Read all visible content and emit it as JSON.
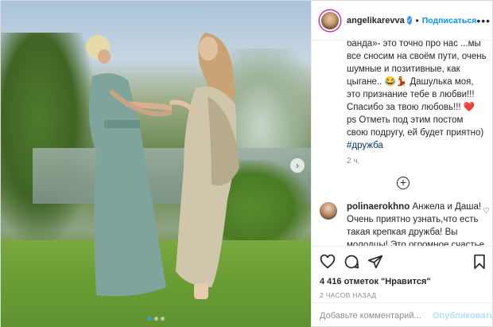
{
  "header": {
    "username": "angelikarevva",
    "follow_label": "Подписаться",
    "separator": "•",
    "more": "•••"
  },
  "caption": {
    "line1": "банда»- это точно про нас ...мы все сносим на своём пути, очень шумные и позитивные, как цыгане..",
    "emoji1": "😂💃",
    "line2": "Дашулька моя, это признание тебе в любви!!! Спасибо за твою любовь!!!",
    "heart": "❤️",
    "line3": "ps Отметь под этим постом свою подругу, ей будет приятно)",
    "hashtag": "#дружба",
    "time": "2 ч."
  },
  "load_more": "+",
  "comment": {
    "username": "polinaerokhno",
    "text": "Анжела и Даша! Очень приятно узнать,что есть такая крепкая дружба! Вы молодцы! Это огромное счастье найти друг друга,наверно это так же важно,как выйти замуж за достойного мужчину. Долгих"
  },
  "actions": {
    "likes_count": "4 416",
    "likes_text": "отметок \"Нравится\"",
    "posted_ago": "2 ЧАСОВ НАЗАД"
  },
  "add_comment": {
    "placeholder": "Добавьте комментарий...",
    "publish_label": "Опубликовать"
  },
  "photo": {
    "next_arrow": "›",
    "slides_total": 3,
    "active_slide": 1
  },
  "colors": {
    "accent": "#0095f6",
    "border": "#dbdbdb",
    "muted": "#8e8e8e",
    "publish_disabled": "#b2dffc"
  },
  "icons": [
    "heart-icon",
    "comment-icon",
    "share-icon",
    "save-icon",
    "verified-icon",
    "plus-circle-icon",
    "like-small-icon"
  ]
}
